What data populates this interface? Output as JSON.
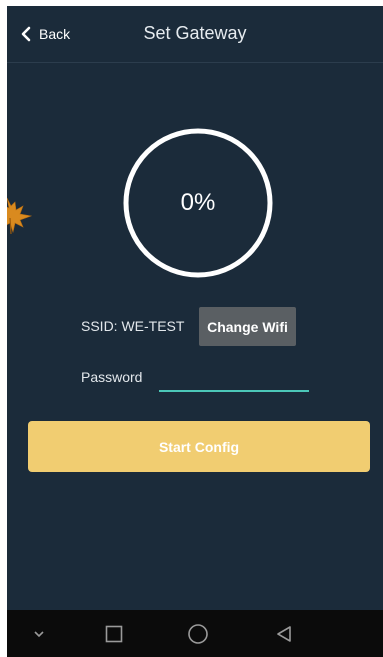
{
  "header": {
    "back_label": "Back",
    "title": "Set Gateway"
  },
  "progress": {
    "value": 0,
    "label": "0%"
  },
  "wifi": {
    "ssid_text": "SSID: WE-TEST",
    "change_label": "Change Wifi"
  },
  "password": {
    "label": "Password",
    "value": ""
  },
  "start_button": {
    "label": "Start Config"
  },
  "colors": {
    "background": "#1b2b3a",
    "accent_underline": "#4cc7b8",
    "start_button": "#f1cd71",
    "change_wifi_button": "#5a5f63",
    "navbar": "#0b0b0b"
  },
  "icons": {
    "back": "chevron-left-icon",
    "leaf": "maple-leaf-icon",
    "nav_menu": "chevron-down-icon",
    "nav_recents": "square-icon",
    "nav_home": "circle-icon",
    "nav_back": "triangle-back-icon"
  }
}
